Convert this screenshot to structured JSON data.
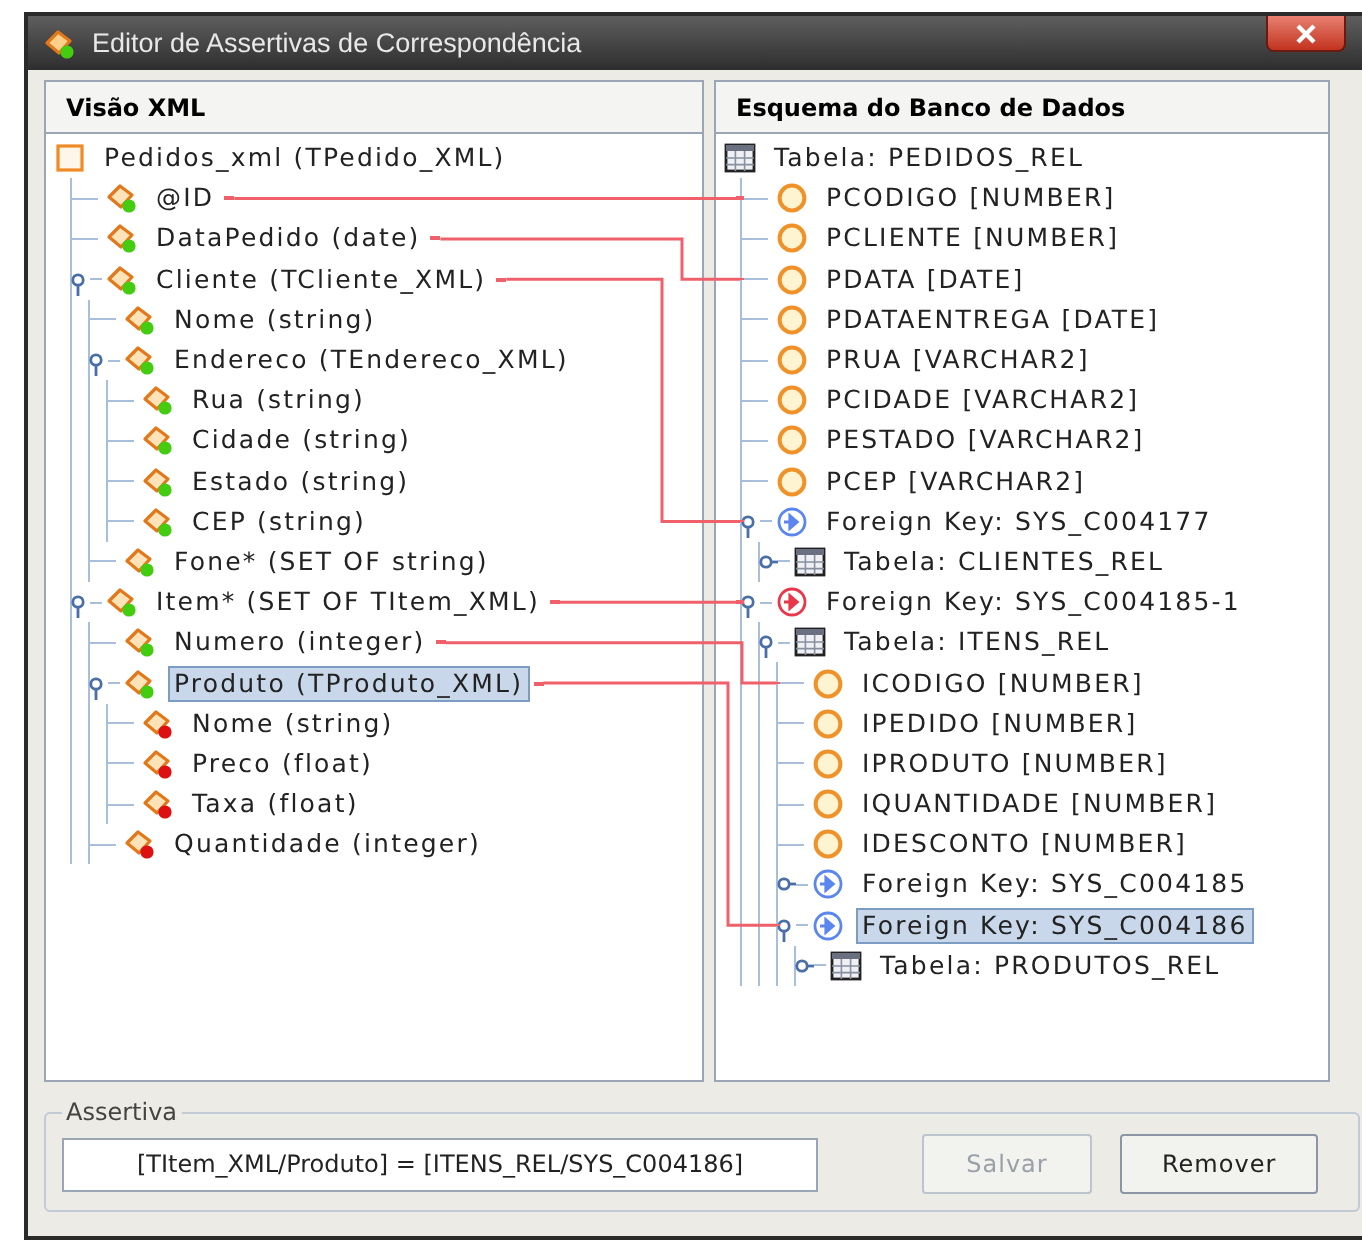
{
  "window": {
    "title": "Editor de Assertivas de Correspondência"
  },
  "xml_view": {
    "title": "Visão XML",
    "items": [
      {
        "kind": "root",
        "label": "Pedidos_xml (TPedido_XML)",
        "selected": false,
        "linked": false,
        "children": [
          {
            "kind": "element",
            "label": "@ID",
            "color": "#44cc11",
            "selected": false,
            "linked": true
          },
          {
            "kind": "element",
            "label": "DataPedido (date)",
            "color": "#44cc11",
            "selected": false,
            "linked": true
          },
          {
            "kind": "element",
            "label": "Cliente (TCliente_XML)",
            "color": "#44cc11",
            "selected": false,
            "linked": true,
            "expanded": true,
            "children": [
              {
                "kind": "element",
                "label": "Nome (string)",
                "color": "#44cc11",
                "selected": false,
                "linked": false
              },
              {
                "kind": "element",
                "label": "Endereco (TEndereco_XML)",
                "color": "#44cc11",
                "selected": false,
                "linked": false,
                "expanded": true,
                "children": [
                  {
                    "kind": "element",
                    "label": "Rua (string)",
                    "color": "#44cc11",
                    "selected": false,
                    "linked": false
                  },
                  {
                    "kind": "element",
                    "label": "Cidade (string)",
                    "color": "#44cc11",
                    "selected": false,
                    "linked": false
                  },
                  {
                    "kind": "element",
                    "label": "Estado (string)",
                    "color": "#44cc11",
                    "selected": false,
                    "linked": false
                  },
                  {
                    "kind": "element",
                    "label": "CEP (string)",
                    "color": "#44cc11",
                    "selected": false,
                    "linked": false
                  }
                ]
              },
              {
                "kind": "element",
                "label": "Fone* (SET OF string)",
                "color": "#44cc11",
                "selected": false,
                "linked": false
              }
            ]
          },
          {
            "kind": "element",
            "label": "Item* (SET OF TItem_XML)",
            "color": "#44cc11",
            "selected": false,
            "linked": true,
            "expanded": true,
            "children": [
              {
                "kind": "element",
                "label": "Numero (integer)",
                "color": "#44cc11",
                "selected": false,
                "linked": true
              },
              {
                "kind": "element",
                "label": "Produto (TProduto_XML)",
                "color": "#44cc11",
                "selected": true,
                "linked": true,
                "expanded": true,
                "children": [
                  {
                    "kind": "element",
                    "label": "Nome (string)",
                    "color": "#dd1111",
                    "selected": false,
                    "linked": false
                  },
                  {
                    "kind": "element",
                    "label": "Preco (float)",
                    "color": "#dd1111",
                    "selected": false,
                    "linked": false
                  },
                  {
                    "kind": "element",
                    "label": "Taxa (float)",
                    "color": "#dd1111",
                    "selected": false,
                    "linked": false
                  }
                ]
              },
              {
                "kind": "element",
                "label": "Quantidade (integer)",
                "color": "#dd1111",
                "selected": false,
                "linked": false
              }
            ]
          }
        ]
      }
    ]
  },
  "schema_view": {
    "title": "Esquema do Banco de Dados",
    "items": [
      {
        "kind": "table",
        "label": "Tabela: PEDIDOS_REL",
        "selected": false,
        "linked": false,
        "children": [
          {
            "kind": "column",
            "label": "PCODIGO [NUMBER]",
            "selected": false,
            "linked": true
          },
          {
            "kind": "column",
            "label": "PCLIENTE [NUMBER]",
            "selected": false,
            "linked": false
          },
          {
            "kind": "column",
            "label": "PDATA [DATE]",
            "selected": false,
            "linked": true
          },
          {
            "kind": "column",
            "label": "PDATAENTREGA [DATE]",
            "selected": false,
            "linked": false
          },
          {
            "kind": "column",
            "label": "PRUA [VARCHAR2]",
            "selected": false,
            "linked": false
          },
          {
            "kind": "column",
            "label": "PCIDADE [VARCHAR2]",
            "selected": false,
            "linked": false
          },
          {
            "kind": "column",
            "label": "PESTADO [VARCHAR2]",
            "selected": false,
            "linked": false
          },
          {
            "kind": "column",
            "label": "PCEP [VARCHAR2]",
            "selected": false,
            "linked": false
          },
          {
            "kind": "foreign_key",
            "label": "Foreign Key: SYS_C004177",
            "color": "#5b86ee",
            "selected": false,
            "linked": true,
            "expanded": true,
            "children": [
              {
                "kind": "table",
                "label": "Tabela: CLIENTES_REL",
                "selected": false,
                "linked": false,
                "expanded": false
              }
            ]
          },
          {
            "kind": "foreign_key",
            "label": "Foreign Key: SYS_C004185-1",
            "color": "#e8364a",
            "selected": false,
            "linked": true,
            "expanded": true,
            "children": [
              {
                "kind": "table",
                "label": "Tabela: ITENS_REL",
                "selected": false,
                "linked": false,
                "expanded": true,
                "children": [
                  {
                    "kind": "column",
                    "label": "ICODIGO [NUMBER]",
                    "selected": false,
                    "linked": true
                  },
                  {
                    "kind": "column",
                    "label": "IPEDIDO [NUMBER]",
                    "selected": false,
                    "linked": false
                  },
                  {
                    "kind": "column",
                    "label": "IPRODUTO [NUMBER]",
                    "selected": false,
                    "linked": false
                  },
                  {
                    "kind": "column",
                    "label": "IQUANTIDADE [NUMBER]",
                    "selected": false,
                    "linked": false
                  },
                  {
                    "kind": "column",
                    "label": "IDESCONTO [NUMBER]",
                    "selected": false,
                    "linked": false
                  },
                  {
                    "kind": "foreign_key",
                    "label": "Foreign Key: SYS_C004185",
                    "color": "#5b86ee",
                    "selected": false,
                    "linked": false,
                    "expanded": false
                  },
                  {
                    "kind": "foreign_key",
                    "label": "Foreign Key: SYS_C004186",
                    "color": "#5b86ee",
                    "selected": true,
                    "linked": true,
                    "expanded": true,
                    "children": [
                      {
                        "kind": "table",
                        "label": "Tabela: PRODUTOS_REL",
                        "selected": false,
                        "linked": false,
                        "expanded": false
                      }
                    ]
                  }
                ]
              }
            ]
          }
        ]
      }
    ]
  },
  "assertion": {
    "title": "Assertiva",
    "value": "[TItem_XML/Produto] = [ITENS_REL/SYS_C004186]",
    "buttons": [
      {
        "label": "Salvar",
        "disabled": true
      },
      {
        "label": "Remover",
        "disabled": false
      }
    ]
  }
}
